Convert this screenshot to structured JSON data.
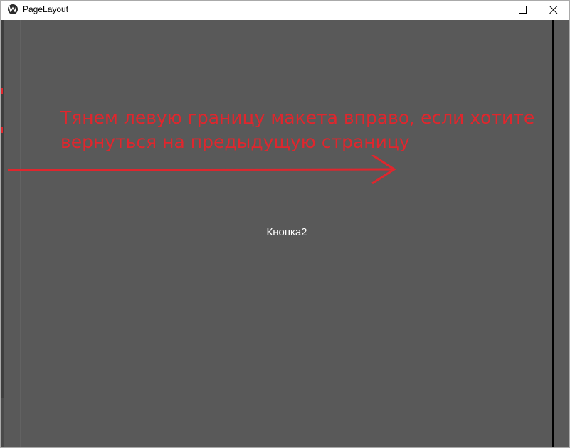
{
  "window": {
    "title": "PageLayout"
  },
  "controls": {
    "minimize_icon": "minimize-icon",
    "maximize_icon": "maximize-icon",
    "close_icon": "close-icon"
  },
  "page": {
    "button_label": "Кнопка2",
    "background_color": "#595959"
  },
  "annotation": {
    "line1": "Тянем левую границу макета вправо, если хотите",
    "line2": "вернуться на предыдущую страницу",
    "color": "#e0262d"
  }
}
